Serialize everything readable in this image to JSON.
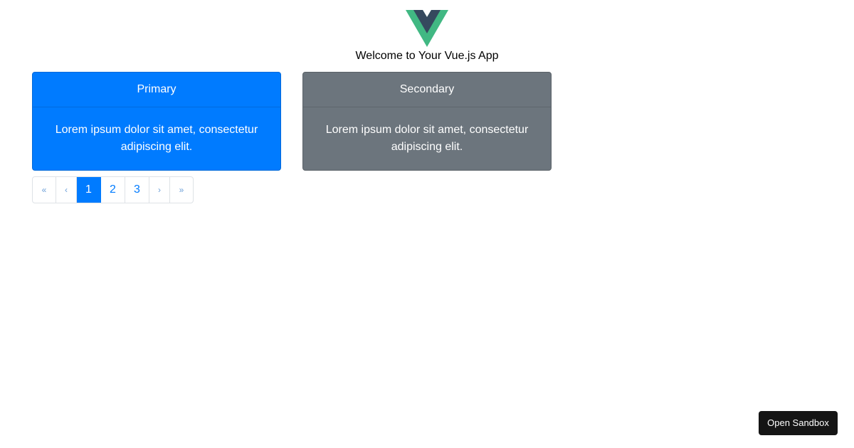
{
  "app": {
    "logo_icon": "vue-logo-icon",
    "welcome": "Welcome to Your Vue.js App"
  },
  "cards": [
    {
      "header": "Primary",
      "body": "Lorem ipsum dolor sit amet, consectetur adipiscing elit.",
      "color": "#007bff"
    },
    {
      "header": "Secondary",
      "body": "Lorem ipsum dolor sit amet, consectetur adipiscing elit.",
      "color": "#6c757d"
    }
  ],
  "pagination": {
    "first": "«",
    "prev": "‹",
    "pages": [
      "1",
      "2",
      "3"
    ],
    "active_page": "1",
    "next": "›",
    "last": "»"
  },
  "sandbox": {
    "button_label": "Open Sandbox"
  },
  "colors": {
    "vue_green": "#41b883",
    "vue_dark": "#35495e",
    "link_blue": "#007bff"
  }
}
